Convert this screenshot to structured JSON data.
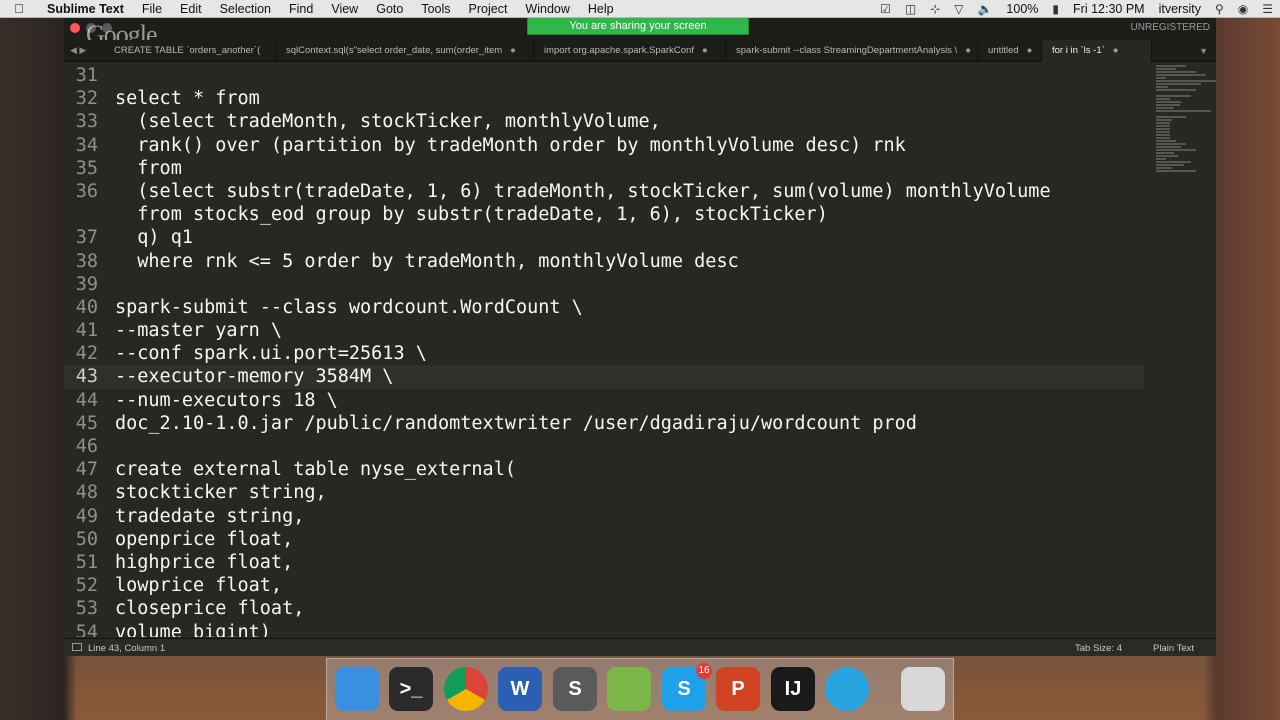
{
  "menubar": {
    "app_name": "Sublime Text",
    "items": [
      "File",
      "Edit",
      "Selection",
      "Find",
      "View",
      "Goto",
      "Tools",
      "Project",
      "Window",
      "Help"
    ],
    "battery": "100%",
    "clock": "Fri 12:30 PM",
    "user": "itversity"
  },
  "share_banner": "You are sharing your screen",
  "window": {
    "unregistered": "UNREGISTERED",
    "google_logo": "Google",
    "tabs": [
      {
        "label": "CREATE TABLE `orders_another`(",
        "active": false
      },
      {
        "label": "sqlContext.sql(s\"select order_date, sum(order_item",
        "active": false
      },
      {
        "label": "import org.apache.spark.SparkConf",
        "active": false
      },
      {
        "label": "spark-submit --class StreamingDepartmentAnalysis \\",
        "active": false
      },
      {
        "label": "untitled",
        "active": false
      },
      {
        "label": "for i in `ls -1`",
        "active": true
      }
    ]
  },
  "code": [
    {
      "num": "31",
      "text": ""
    },
    {
      "num": "32",
      "text": "select * from"
    },
    {
      "num": "33",
      "text": "  (select tradeMonth, stockTicker, monthlyVolume,"
    },
    {
      "num": "34",
      "text": "  rank() over (partition by tradeMonth order by monthlyVolume desc) rnk"
    },
    {
      "num": "35",
      "text": "  from"
    },
    {
      "num": "36",
      "text": "  (select substr(tradeDate, 1, 6) tradeMonth, stockTicker, sum(volume) monthlyVolume"
    },
    {
      "num": "",
      "text": "  from stocks_eod group by substr(tradeDate, 1, 6), stockTicker)"
    },
    {
      "num": "37",
      "text": "  q) q1"
    },
    {
      "num": "38",
      "text": "  where rnk <= 5 order by tradeMonth, monthlyVolume desc"
    },
    {
      "num": "39",
      "text": ""
    },
    {
      "num": "40",
      "text": "spark-submit --class wordcount.WordCount \\"
    },
    {
      "num": "41",
      "text": "--master yarn \\"
    },
    {
      "num": "42",
      "text": "--conf spark.ui.port=25613 \\"
    },
    {
      "num": "43",
      "text": "--executor-memory 3584M \\"
    },
    {
      "num": "44",
      "text": "--num-executors 18 \\"
    },
    {
      "num": "45",
      "text": "doc_2.10-1.0.jar /public/randomtextwriter /user/dgadiraju/wordcount prod"
    },
    {
      "num": "46",
      "text": ""
    },
    {
      "num": "47",
      "text": "create external table nyse_external("
    },
    {
      "num": "48",
      "text": "stockticker string,"
    },
    {
      "num": "49",
      "text": "tradedate string,"
    },
    {
      "num": "50",
      "text": "openprice float,"
    },
    {
      "num": "51",
      "text": "highprice float,"
    },
    {
      "num": "52",
      "text": "lowprice float,"
    },
    {
      "num": "53",
      "text": "closeprice float,"
    },
    {
      "num": "54",
      "text": "volume bigint)"
    }
  ],
  "statusbar": {
    "position": "Line 43, Column 1",
    "tab_size": "Tab Size: 4",
    "syntax": "Plain Text"
  },
  "dock": {
    "items": [
      {
        "name": "finder-icon",
        "label": "",
        "color": "#3b8fe0"
      },
      {
        "name": "terminal-icon",
        "label": ">_",
        "color": "#2b2b2b"
      },
      {
        "name": "chrome-icon",
        "label": "",
        "color": "#e8e8e8"
      },
      {
        "name": "word-icon",
        "label": "W",
        "color": "#2b5fb4"
      },
      {
        "name": "sublime-icon",
        "label": "S",
        "color": "#5a5a5a"
      },
      {
        "name": "sourcetree-icon",
        "label": "",
        "color": "#7ab648"
      },
      {
        "name": "skype-icon",
        "label": "S",
        "color": "#1ea1e8",
        "badge": "16"
      },
      {
        "name": "powerpoint-icon",
        "label": "P",
        "color": "#d04423"
      },
      {
        "name": "intellij-icon",
        "label": "IJ",
        "color": "#1a1a1a"
      },
      {
        "name": "browser-icon",
        "label": "",
        "color": "#2aa4e0"
      },
      {
        "name": "trash-icon",
        "label": "",
        "color": "#d8d8d8"
      }
    ]
  }
}
